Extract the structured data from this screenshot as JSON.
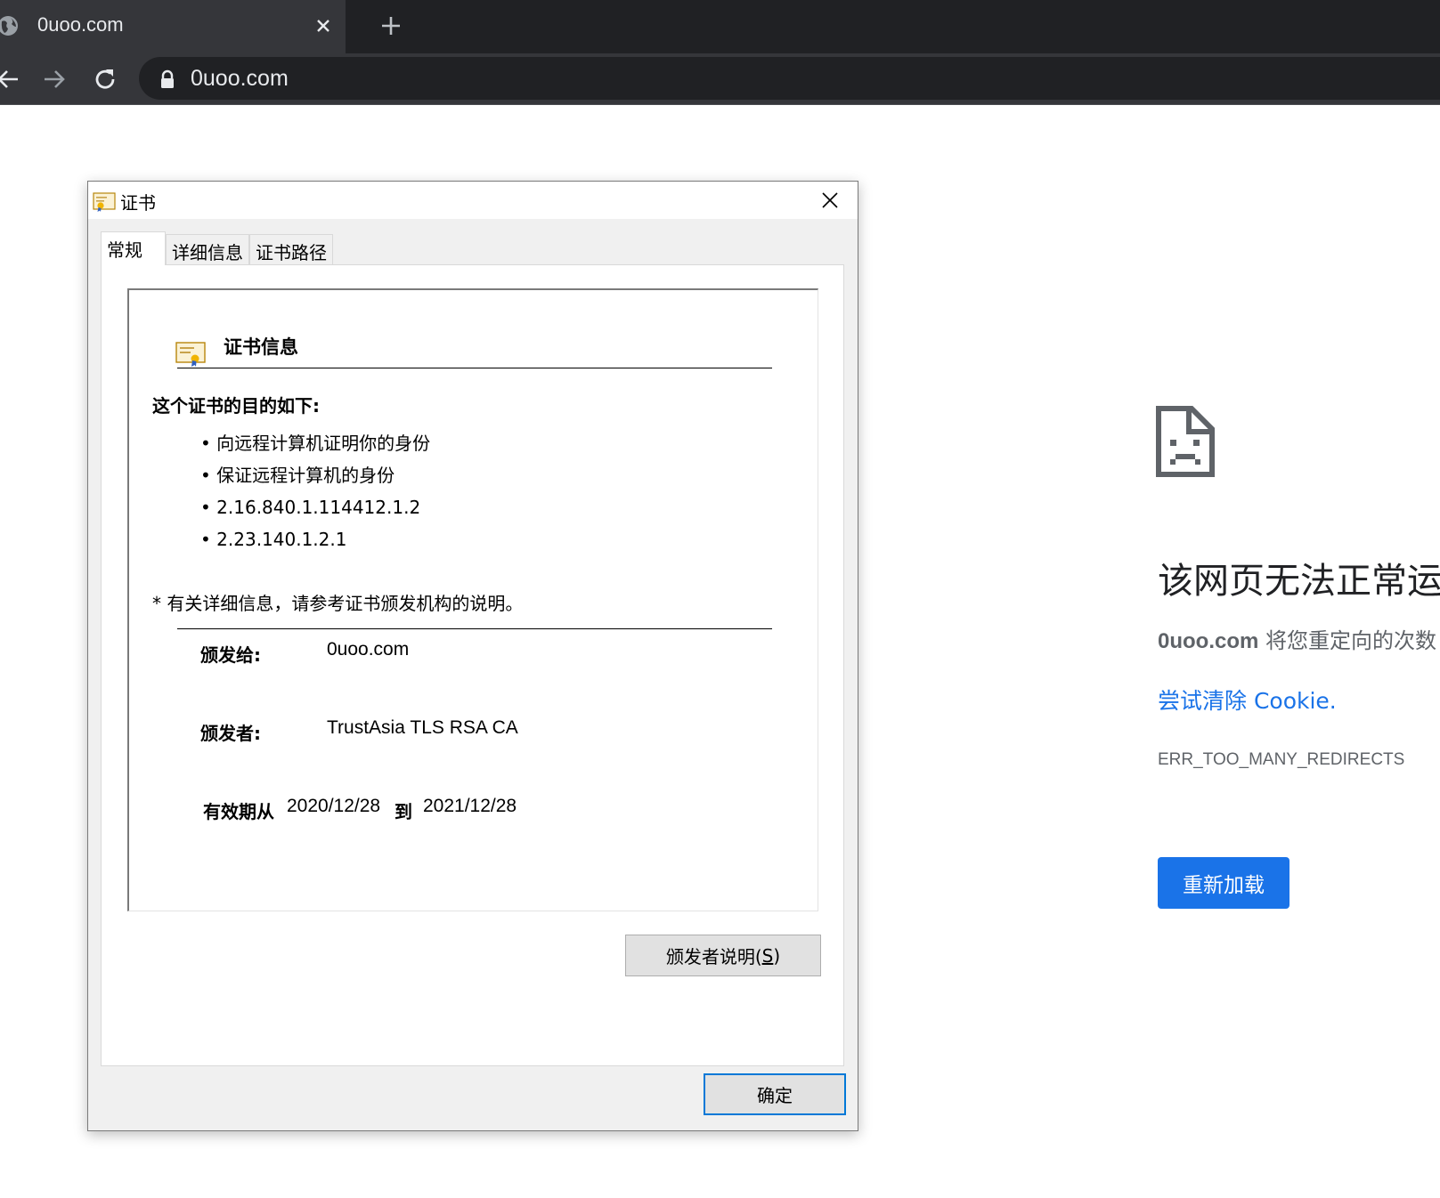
{
  "browser": {
    "tab_title": "0uoo.com",
    "url": "0uoo.com",
    "icons": {
      "tab_favicon": "globe-icon",
      "tab_close": "close-icon",
      "new_tab": "plus-icon",
      "back": "arrow-left-icon",
      "forward": "arrow-right-icon",
      "reload": "reload-icon",
      "lock": "lock-icon"
    }
  },
  "error_page": {
    "title": "该网页无法正常运",
    "subtitle_domain": "0uoo.com",
    "subtitle_rest": " 将您重定向的次数",
    "link": "尝试清除 Cookie.",
    "error_code": "ERR_TOO_MANY_REDIRECTS",
    "reload_button": "重新加载",
    "accent_color": "#1a73e8"
  },
  "dialog": {
    "title": "证书",
    "tabs": [
      "常规",
      "详细信息",
      "证书路径"
    ],
    "active_tab": "常规",
    "info_heading": "证书信息",
    "purpose_label": "这个证书的目的如下:",
    "purposes": [
      "向远程计算机证明你的身份",
      "保证远程计算机的身份",
      "2.16.840.1.114412.1.2",
      "2.23.140.1.2.1"
    ],
    "note": "* 有关详细信息，请参考证书颁发机构的说明。",
    "issued_to_label": "颁发给:",
    "issued_to_value": "0uoo.com",
    "issued_by_label": "颁发者:",
    "issued_by_value": "TrustAsia TLS RSA CA",
    "valid_from_label": "有效期从",
    "valid_from": "2020/12/28",
    "valid_to_label": "到",
    "valid_to": "2021/12/28",
    "issuer_statement_button_text": "颁发者说明(",
    "issuer_statement_button_key": "S",
    "issuer_statement_button_end": ")",
    "ok_button": "确定"
  }
}
